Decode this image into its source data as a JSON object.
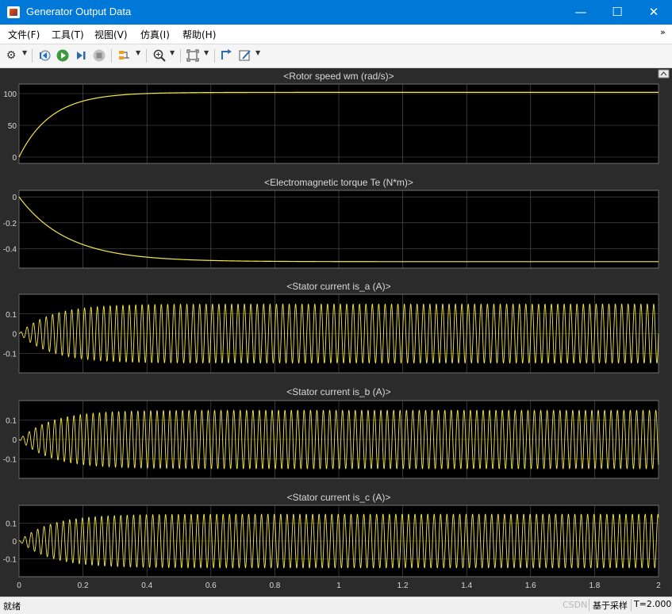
{
  "window": {
    "title": "Generator Output Data",
    "minimize_glyph": "—",
    "maximize_glyph": "☐",
    "close_glyph": "✕"
  },
  "menu": {
    "items": [
      "文件(F)",
      "工具(T)",
      "视图(V)",
      "仿真(I)",
      "帮助(H)"
    ],
    "overflow_glyph": "»"
  },
  "toolbar": {
    "icons": [
      "gear-icon",
      "step-back-icon",
      "run-icon",
      "step-forward-icon",
      "stop-icon",
      "signal-selector-icon",
      "zoom-icon",
      "fit-to-view-icon",
      "triggers-icon",
      "style-icon"
    ]
  },
  "status": {
    "left_text": "就绪",
    "sample_label": "基于采样",
    "time_label": "T=2.000",
    "watermark": "CSDN @Stanley_ztu"
  },
  "colors": {
    "plot_bg": "#000000",
    "frame_bg": "#2b2b2b",
    "trace": "#f5e84a",
    "grid": "#5a5a5a",
    "axis_text": "#d8d8d8"
  },
  "chart_data": [
    {
      "type": "line",
      "title": "<Rotor speed wm (rad/s)>",
      "xlim": [
        0,
        2
      ],
      "ylim": [
        -10,
        115
      ],
      "yticks": [
        0,
        50,
        100
      ],
      "ytick_labels": [
        "0",
        "50",
        "100"
      ],
      "grid": true,
      "series": [
        {
          "shape": "exp_rise",
          "start": 0,
          "final": 102,
          "tau": 0.1
        }
      ]
    },
    {
      "type": "line",
      "title": "<Electromagnetic torque Te (N*m)>",
      "xlim": [
        0,
        2
      ],
      "ylim": [
        -0.55,
        0.05
      ],
      "yticks": [
        0,
        -0.2,
        -0.4
      ],
      "ytick_labels": [
        "0",
        "-0.2",
        "-0.4"
      ],
      "grid": true,
      "series": [
        {
          "shape": "exp_rise",
          "start": 0,
          "final": -0.5,
          "tau": 0.15
        }
      ]
    },
    {
      "type": "line",
      "title": "<Stator current is_a (A)>",
      "xlim": [
        0,
        2
      ],
      "ylim": [
        -0.2,
        0.2
      ],
      "yticks": [
        0.1,
        0,
        -0.1
      ],
      "ytick_labels": [
        "0.1",
        "0",
        "-0.1"
      ],
      "grid": true,
      "series": [
        {
          "shape": "growing_sine",
          "amplitude": 0.15,
          "tau": 0.1,
          "phase_deg": 0
        }
      ]
    },
    {
      "type": "line",
      "title": "<Stator current is_b (A)>",
      "xlim": [
        0,
        2
      ],
      "ylim": [
        -0.2,
        0.2
      ],
      "yticks": [
        0.1,
        0,
        -0.1
      ],
      "ytick_labels": [
        "0.1",
        "0",
        "-0.1"
      ],
      "grid": true,
      "series": [
        {
          "shape": "growing_sine",
          "amplitude": 0.15,
          "tau": 0.1,
          "phase_deg": 240
        }
      ]
    },
    {
      "type": "line",
      "title": "<Stator current is_c (A)>",
      "xlim": [
        0,
        2
      ],
      "ylim": [
        -0.2,
        0.2
      ],
      "yticks": [
        0.1,
        0,
        -0.1
      ],
      "ytick_labels": [
        "0.1",
        "0",
        "-0.1"
      ],
      "grid": true,
      "series": [
        {
          "shape": "growing_sine",
          "amplitude": 0.15,
          "tau": 0.1,
          "phase_deg": 120
        }
      ]
    }
  ],
  "x_axis": {
    "ticks": [
      0,
      0.2,
      0.4,
      0.6,
      0.8,
      1,
      1.2,
      1.4,
      1.6,
      1.8,
      2
    ],
    "tick_labels": [
      "0",
      "0.2",
      "0.4",
      "0.6",
      "0.8",
      "1",
      "1.2",
      "1.4",
      "1.6",
      "1.8",
      "2"
    ]
  }
}
